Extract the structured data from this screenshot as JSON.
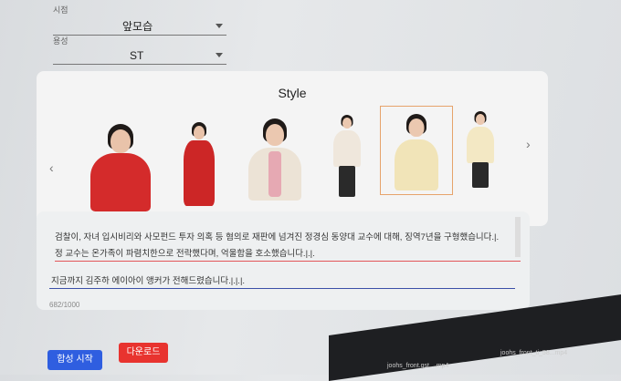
{
  "form": {
    "viewpoint": {
      "label": "시점",
      "value": "앞모습"
    },
    "purpose": {
      "label": "용성",
      "value": "ST"
    }
  },
  "style": {
    "title": "Style",
    "prev_icon": "chevron-left-icon",
    "next_icon": "chevron-right-icon",
    "selected_index": 4
  },
  "script": {
    "lines": [
      "검찰이, 자녀 입시비리와 사모펀드 투자 의혹 등 혐의로 재판에 넘겨진 정경심 동양대 교수에 대해, 징역7년을 구형했습니다.|.",
      "정 교수는 온가족이 파렴치한으로 전락했다며, 억울함을 호소했습니다.|.|.",
      "지금까지 김주하 에이아이 앵커가 전해드렸습니다.|.|.|."
    ],
    "counter": "682/1000"
  },
  "buttons": {
    "synthesize": "합성 시작",
    "download": "다운로드"
  },
  "taskbar": {
    "items": [
      "joohs_front.gst....mp4",
      "joohs_front_ti_58...mp4"
    ]
  },
  "colors": {
    "synthesize": "#2f5ee0",
    "download": "#e8332f",
    "selected_border": "#e6a36b"
  }
}
